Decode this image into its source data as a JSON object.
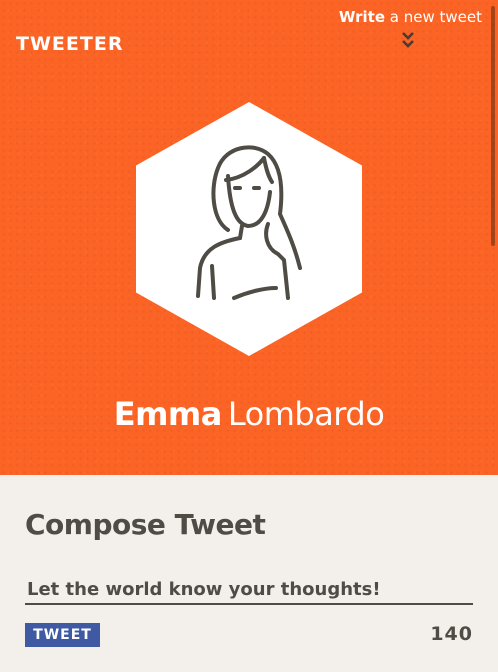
{
  "header": {
    "brand": "TWEETER",
    "write_link_bold": "Write",
    "write_link_rest": " a new tweet"
  },
  "profile": {
    "first_name": "Emma",
    "last_name": "Lombardo"
  },
  "compose": {
    "title": "Compose Tweet",
    "input_placeholder": "Let the world know your thoughts!",
    "input_value": "",
    "tweet_button_label": "TWEET",
    "char_count": "140"
  },
  "colors": {
    "hero_orange": "#fb6425",
    "panel_bg": "#f3f0ec",
    "text_dark": "#4f4b45",
    "button_blue": "#3f5aa3"
  },
  "icons": {
    "avatar": "woman-avatar-icon",
    "write_chevron": "double-chevron-down-icon"
  }
}
